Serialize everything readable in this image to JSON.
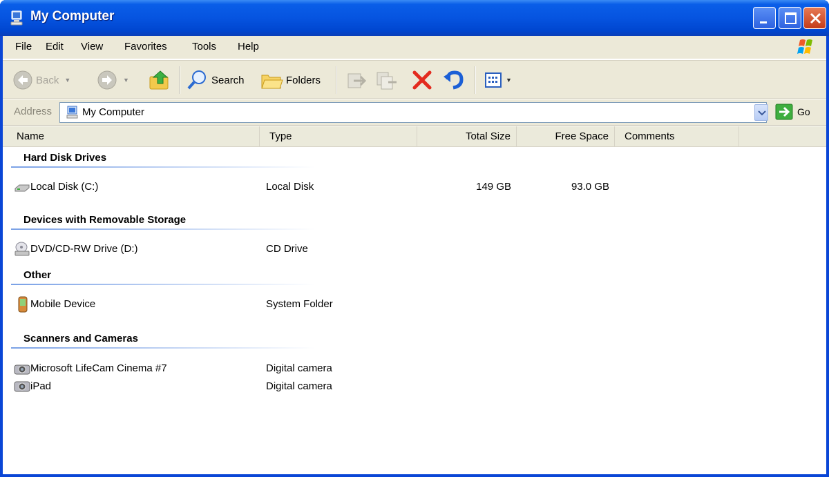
{
  "window": {
    "title": "My Computer"
  },
  "menu": [
    "File",
    "Edit",
    "View",
    "Favorites",
    "Tools",
    "Help"
  ],
  "toolbar": {
    "back": "Back",
    "search": "Search",
    "folders": "Folders"
  },
  "address": {
    "label": "Address",
    "value": "My Computer",
    "go": "Go"
  },
  "columns": {
    "name": "Name",
    "type": "Type",
    "total_size": "Total Size",
    "free_space": "Free Space",
    "comments": "Comments"
  },
  "groups": [
    {
      "title": "Hard Disk Drives",
      "items": [
        {
          "name": "Local Disk (C:)",
          "type": "Local Disk",
          "total_size": "149 GB",
          "free_space": "93.0 GB",
          "icon": "hard-disk-icon"
        }
      ]
    },
    {
      "title": "Devices with Removable Storage",
      "items": [
        {
          "name": "DVD/CD-RW Drive (D:)",
          "type": "CD Drive",
          "icon": "cd-drive-icon"
        }
      ]
    },
    {
      "title": "Other",
      "items": [
        {
          "name": "Mobile Device",
          "type": "System Folder",
          "icon": "mobile-device-icon"
        }
      ]
    },
    {
      "title": "Scanners and Cameras",
      "items": [
        {
          "name": "Microsoft LifeCam Cinema #7",
          "type": "Digital camera",
          "icon": "camera-icon"
        },
        {
          "name": "iPad",
          "type": "Digital camera",
          "icon": "camera-icon"
        }
      ]
    }
  ],
  "colors": {
    "title_bar": "#0054e3",
    "chrome": "#ece9d8",
    "group_line": "#7aa1e6"
  }
}
